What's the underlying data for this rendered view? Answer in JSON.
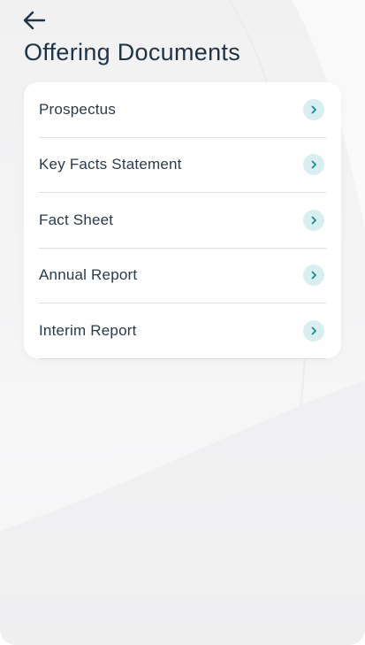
{
  "header": {
    "title": "Offering Documents"
  },
  "documents": [
    {
      "label": "Prospectus"
    },
    {
      "label": "Key Facts Statement"
    },
    {
      "label": "Fact Sheet"
    },
    {
      "label": "Annual Report"
    },
    {
      "label": "Interim Report"
    }
  ],
  "icons": {
    "back": "arrow-left-icon",
    "item": "chevron-right-icon"
  },
  "colors": {
    "title": "#1f3347",
    "chevron": "#1a8a96",
    "chevron_bg": "#d8eef0",
    "divider": "#dadde1"
  }
}
